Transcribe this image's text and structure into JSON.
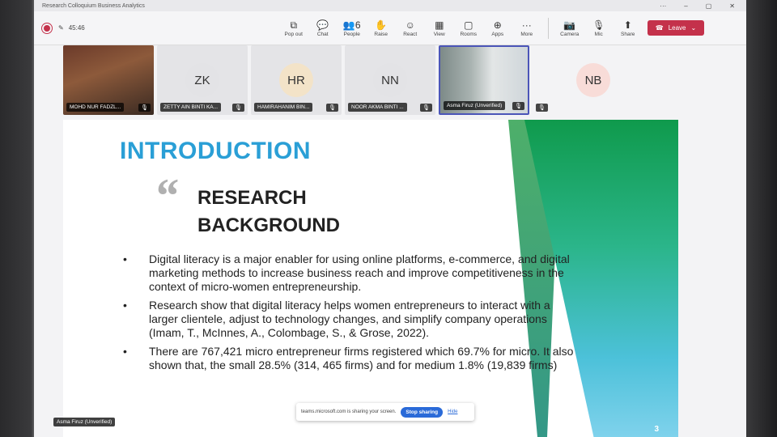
{
  "window": {
    "title": "Research Colloquium Business Analytics"
  },
  "toolbar": {
    "timer": "45:46",
    "tools": [
      {
        "label": "Pop out",
        "icon": "pop-out-icon",
        "glyph": "⧉"
      },
      {
        "label": "Chat",
        "icon": "chat-icon",
        "glyph": "💬"
      },
      {
        "label": "People",
        "icon": "people-icon",
        "glyph": "👥",
        "badge": "6"
      },
      {
        "label": "Raise",
        "icon": "raise-hand-icon",
        "glyph": "✋"
      },
      {
        "label": "React",
        "icon": "react-icon",
        "glyph": "☺"
      },
      {
        "label": "View",
        "icon": "view-icon",
        "glyph": "▦"
      },
      {
        "label": "Rooms",
        "icon": "rooms-icon",
        "glyph": "▢"
      },
      {
        "label": "Apps",
        "icon": "apps-icon",
        "glyph": "⊕"
      },
      {
        "label": "More",
        "icon": "more-icon",
        "glyph": "···"
      }
    ],
    "camera_label": "Camera",
    "mic_label": "Mic",
    "share_label": "Share",
    "leave_label": "Leave"
  },
  "participants": [
    {
      "name": "MOHD NUR FADZL...",
      "type": "video1"
    },
    {
      "name": "ZETTY AIN BINTI KA...",
      "initials": "ZK",
      "color": "#e3e3e6"
    },
    {
      "name": "HAMIRAHANIM BIN...",
      "initials": "HR",
      "color": "#f3e3c8"
    },
    {
      "name": "NOOR AKMA BINTI ...",
      "initials": "NN",
      "color": "#e3e3e6"
    },
    {
      "name": "Asma Firuz (Unverified)",
      "type": "video2"
    },
    {
      "name": "",
      "initials": "NB",
      "color": "#f8dcd8",
      "type": "plain"
    }
  ],
  "slide": {
    "title": "INTRODUCTION",
    "quote_mark": "“",
    "subtitle": "RESEARCH BACKGROUND",
    "bullets": [
      "Digital literacy is a major enabler for using online platforms, e-commerce, and digital marketing methods to increase business reach and improve competitiveness in the context of micro-women entrepreneurship.",
      "Research show that digital literacy helps women entrepreneurs to interact with a larger clientele, adjust to technology changes, and simplify company operations (Imam, T., McInnes, A., Colombage, S., & Grose, 2022).",
      "There are 767,421 micro entrepreneur firms registered which 69.7% for micro. It also shown that, the small 28.5% (314, 465 firms) and for medium 1.8% (19,839 firms)"
    ],
    "page_number": "3"
  },
  "share_banner": {
    "text": "teams.microsoft.com is sharing your screen.",
    "stop_label": "Stop sharing",
    "hide_label": "Hide"
  },
  "presenter_label": "Asma Firuz (Unverified)"
}
